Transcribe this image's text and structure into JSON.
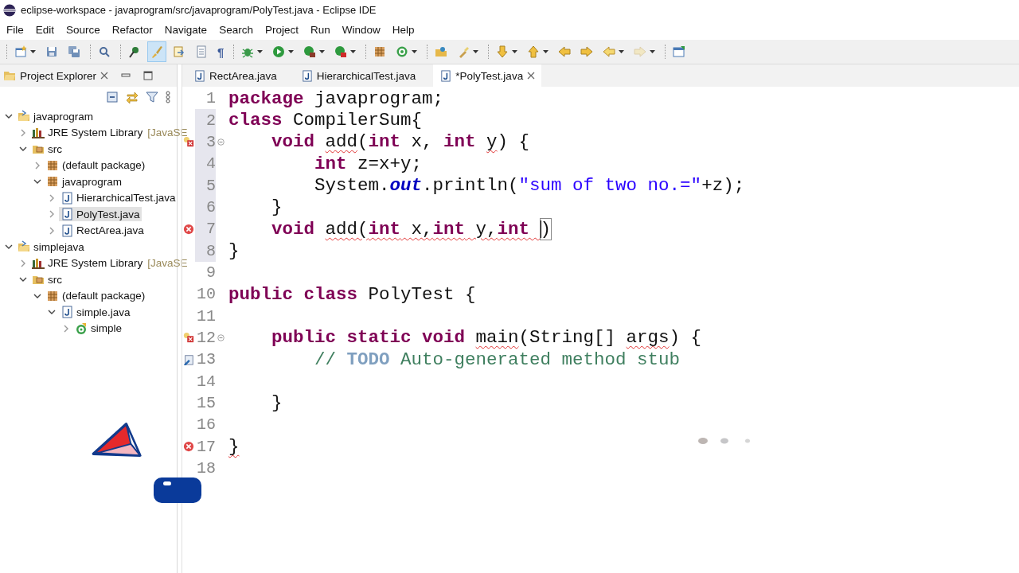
{
  "window": {
    "title": "eclipse-workspace - javaprogram/src/javaprogram/PolyTest.java - Eclipse IDE"
  },
  "menu": [
    "File",
    "Edit",
    "Source",
    "Refactor",
    "Navigate",
    "Search",
    "Project",
    "Run",
    "Window",
    "Help"
  ],
  "toolbar": [
    [
      {
        "kind": "new",
        "dropdown": true,
        "pressed": false,
        "disabled": false
      },
      {
        "kind": "save",
        "dropdown": false,
        "pressed": false,
        "disabled": false
      },
      {
        "kind": "save-all",
        "dropdown": false,
        "pressed": false,
        "disabled": false
      }
    ],
    [
      {
        "kind": "search",
        "dropdown": false,
        "pressed": false,
        "disabled": false
      }
    ],
    [
      {
        "kind": "pin",
        "dropdown": false,
        "pressed": false,
        "disabled": false
      },
      {
        "kind": "brush",
        "dropdown": false,
        "pressed": true,
        "disabled": false
      },
      {
        "kind": "doc-arrow",
        "dropdown": false,
        "pressed": false,
        "disabled": false
      },
      {
        "kind": "page",
        "dropdown": false,
        "pressed": false,
        "disabled": false
      },
      {
        "kind": "glyph",
        "glyph": "¶",
        "dropdown": false,
        "pressed": false,
        "disabled": false
      }
    ],
    [
      {
        "kind": "bug",
        "dropdown": true,
        "pressed": false,
        "disabled": false
      },
      {
        "kind": "run",
        "dropdown": true,
        "pressed": false,
        "disabled": false
      },
      {
        "kind": "coverage",
        "dropdown": true,
        "pressed": false,
        "disabled": false
      },
      {
        "kind": "external",
        "dropdown": true,
        "pressed": false,
        "disabled": false
      }
    ],
    [
      {
        "kind": "package",
        "dropdown": false,
        "pressed": false,
        "disabled": false
      },
      {
        "kind": "new-class",
        "dropdown": true,
        "pressed": false,
        "disabled": false
      }
    ],
    [
      {
        "kind": "open-type",
        "dropdown": false,
        "pressed": false,
        "disabled": false
      },
      {
        "kind": "torch",
        "dropdown": true,
        "pressed": false,
        "disabled": false
      }
    ],
    [
      {
        "kind": "next-ann",
        "dropdown": true,
        "pressed": false,
        "disabled": false
      },
      {
        "kind": "prev-ann",
        "dropdown": true,
        "pressed": false,
        "disabled": false
      },
      {
        "kind": "left-edit",
        "dropdown": false,
        "pressed": false,
        "disabled": false
      },
      {
        "kind": "right-edit",
        "dropdown": false,
        "pressed": false,
        "disabled": false
      },
      {
        "kind": "back",
        "dropdown": true,
        "pressed": false,
        "disabled": false
      },
      {
        "kind": "forward",
        "dropdown": true,
        "pressed": false,
        "disabled": true
      }
    ],
    [
      {
        "kind": "perspective",
        "dropdown": false,
        "pressed": false,
        "disabled": false
      }
    ]
  ],
  "explorer": {
    "title": "Project Explorer",
    "tree": [
      {
        "label": "javaprogram",
        "kind": "project",
        "expanded": true,
        "selected": false,
        "children": [
          {
            "label": "JRE System Library",
            "decoration": "[JavaSE",
            "kind": "library",
            "expanded": false,
            "selected": false
          },
          {
            "label": "src",
            "kind": "src",
            "expanded": true,
            "selected": false,
            "children": [
              {
                "label": "(default package)",
                "kind": "package",
                "expanded": false,
                "selected": false
              },
              {
                "label": "javaprogram",
                "kind": "package",
                "expanded": true,
                "selected": false,
                "children": [
                  {
                    "label": "HierarchicalTest.java",
                    "kind": "java",
                    "expanded": false,
                    "selected": false
                  },
                  {
                    "label": "PolyTest.java",
                    "kind": "java",
                    "expanded": false,
                    "selected": true
                  },
                  {
                    "label": "RectArea.java",
                    "kind": "java",
                    "expanded": false,
                    "selected": false
                  }
                ]
              }
            ]
          }
        ]
      },
      {
        "label": "simplejava",
        "kind": "project",
        "expanded": true,
        "selected": false,
        "children": [
          {
            "label": "JRE System Library",
            "decoration": "[JavaSE",
            "kind": "library",
            "expanded": false,
            "selected": false
          },
          {
            "label": "src",
            "kind": "src",
            "expanded": true,
            "selected": false,
            "children": [
              {
                "label": "(default package)",
                "kind": "package",
                "expanded": true,
                "selected": false,
                "children": [
                  {
                    "label": "simple.java",
                    "kind": "java",
                    "expanded": true,
                    "selected": false,
                    "children": [
                      {
                        "label": "simple",
                        "kind": "class",
                        "expanded": false,
                        "selected": false
                      }
                    ]
                  }
                ]
              }
            ]
          }
        ]
      }
    ]
  },
  "editor": {
    "tabs": [
      {
        "label": "RectArea.java",
        "selected": false
      },
      {
        "label": "HierarchicalTest.java",
        "selected": false
      },
      {
        "label": "*PolyTest.java",
        "selected": true
      }
    ],
    "lines": [
      {
        "number": "1",
        "in_range": false,
        "fold": false,
        "segments": [
          {
            "kind": "kw",
            "text": "package",
            "error": false
          },
          {
            "kind": "plain",
            "text": " javaprogram;",
            "error": false
          }
        ]
      },
      {
        "number": "2",
        "in_range": true,
        "fold": false,
        "segments": [
          {
            "kind": "kw",
            "text": "class",
            "error": false
          },
          {
            "kind": "plain",
            "text": " CompilerSum{",
            "error": false
          }
        ],
        "children": [
          {
            "number": "3",
            "in_range": true,
            "fold": true,
            "marker": {
              "kind": "quickfix-error"
            },
            "segments": [
              {
                "kind": "kw",
                "text": "void ",
                "error": false
              },
              {
                "kind": "plain",
                "text": "add",
                "error": true
              },
              {
                "kind": "plain",
                "text": "(",
                "error": false
              },
              {
                "kind": "kw",
                "text": "int ",
                "error": false
              },
              {
                "kind": "plain",
                "text": "x, ",
                "error": false
              },
              {
                "kind": "kw",
                "text": "int ",
                "error": false
              },
              {
                "kind": "plain",
                "text": "y",
                "error": true
              },
              {
                "kind": "plain",
                "text": ") {",
                "error": false
              }
            ],
            "children": [
              {
                "number": "4",
                "in_range": true,
                "fold": false,
                "segments": [
                  {
                    "kind": "kw",
                    "text": "int",
                    "error": false
                  },
                  {
                    "kind": "plain",
                    "text": " z=x+y;",
                    "error": false
                  }
                ]
              },
              {
                "number": "5",
                "in_range": true,
                "fold": false,
                "segments": [
                  {
                    "kind": "plain",
                    "text": "System.",
                    "error": false
                  },
                  {
                    "kind": "field",
                    "text": "out",
                    "error": false
                  },
                  {
                    "kind": "plain",
                    "text": ".println(",
                    "error": false
                  },
                  {
                    "kind": "str",
                    "text": "\"sum of two no.=\"",
                    "error": false
                  },
                  {
                    "kind": "plain",
                    "text": "+z);",
                    "error": false
                  }
                ]
              }
            ]
          },
          {
            "number": "6",
            "in_range": true,
            "fold": false,
            "segments": [
              {
                "kind": "plain",
                "text": "}",
                "error": false
              }
            ]
          },
          {
            "number": "7",
            "in_range": true,
            "fold": false,
            "marker": {
              "kind": "error"
            },
            "segments": [
              {
                "kind": "kw",
                "text": "void ",
                "error": false
              },
              {
                "kind": "plain",
                "text": "add(",
                "error": true
              },
              {
                "kind": "kw",
                "text": "int",
                "error": true
              },
              {
                "kind": "plain",
                "text": " x,",
                "error": true
              },
              {
                "kind": "kw",
                "text": "int",
                "error": true
              },
              {
                "kind": "plain",
                "text": " y,",
                "error": true
              },
              {
                "kind": "kw",
                "text": "int ",
                "error": true
              },
              {
                "kind": "bracket",
                "text": ")",
                "caret": true,
                "error": false
              }
            ]
          }
        ]
      },
      {
        "number": "8",
        "in_range": true,
        "fold": false,
        "segments": [
          {
            "kind": "plain",
            "text": "}",
            "error": false
          }
        ]
      },
      {
        "number": "9",
        "in_range": false,
        "fold": false
      },
      {
        "number": "10",
        "in_range": false,
        "fold": false,
        "segments": [
          {
            "kind": "kw",
            "text": "public ",
            "error": false
          },
          {
            "kind": "kw",
            "text": "class ",
            "error": false
          },
          {
            "kind": "plain",
            "text": "PolyTest {",
            "error": false
          }
        ],
        "children": [
          {
            "number": "11",
            "in_range": false,
            "fold": false
          },
          {
            "number": "12",
            "in_range": false,
            "fold": true,
            "marker": {
              "kind": "quickfix-error"
            },
            "segments": [
              {
                "kind": "kw",
                "text": "public ",
                "error": false
              },
              {
                "kind": "kw",
                "text": "static ",
                "error": false
              },
              {
                "kind": "kw",
                "text": "void ",
                "error": false
              },
              {
                "kind": "plain",
                "text": "main",
                "error": true
              },
              {
                "kind": "plain",
                "text": "(String[] ",
                "error": false
              },
              {
                "kind": "plain",
                "text": "args",
                "error": true
              },
              {
                "kind": "plain",
                "text": ") {",
                "error": false
              }
            ],
            "children": [
              {
                "number": "13",
                "in_range": false,
                "fold": false,
                "marker": {
                  "kind": "task"
                },
                "segments": [
                  {
                    "kind": "comment",
                    "text": "// ",
                    "error": false
                  },
                  {
                    "kind": "todo",
                    "text": "TODO",
                    "error": false
                  },
                  {
                    "kind": "comment",
                    "text": " Auto-generated method stub",
                    "error": false
                  }
                ]
              },
              {
                "number": "14",
                "in_range": false,
                "fold": false
              }
            ]
          },
          {
            "number": "15",
            "in_range": false,
            "fold": false,
            "segments": [
              {
                "kind": "plain",
                "text": "}",
                "error": false
              }
            ]
          },
          {
            "number": "16",
            "in_range": false,
            "fold": false
          }
        ]
      },
      {
        "number": "17",
        "in_range": false,
        "fold": false,
        "marker": {
          "kind": "error"
        },
        "segments": [
          {
            "kind": "plain",
            "text": "}",
            "error": true
          }
        ]
      },
      {
        "number": "18",
        "in_range": false,
        "fold": false
      }
    ]
  }
}
